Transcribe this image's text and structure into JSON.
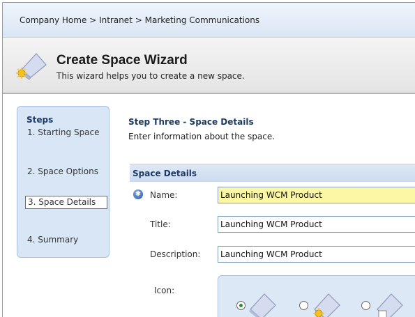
{
  "breadcrumb": {
    "items": [
      "Company Home",
      "Intranet",
      "Marketing Communications"
    ],
    "separator": ">"
  },
  "wizard": {
    "title": "Create Space Wizard",
    "subtitle": "This wizard helps you to create a new space.",
    "icon": "space-wizard-icon"
  },
  "steps": {
    "title": "Steps",
    "items": [
      {
        "label": "1. Starting Space",
        "active": false
      },
      {
        "label": "2. Space Options",
        "active": false
      },
      {
        "label": "3. Space Details",
        "active": true
      },
      {
        "label": "4. Summary",
        "active": false
      }
    ]
  },
  "main": {
    "step_title": "Step Three - Space Details",
    "step_desc": "Enter information about the space.",
    "section_title": "Space Details",
    "required_icon": "required-asterisk-icon",
    "fields": {
      "name": {
        "label": "Name:",
        "value": "Launching WCM Product",
        "required": true
      },
      "title": {
        "label": "Title:",
        "value": "Launching WCM Product"
      },
      "description": {
        "label": "Description:",
        "value": "Launching WCM Product"
      }
    },
    "icon_label": "Icon:",
    "icon_options": [
      {
        "icon": "space-icon-plain",
        "selected": true
      },
      {
        "icon": "space-icon-star",
        "selected": false
      },
      {
        "icon": "space-icon-document",
        "selected": false
      }
    ]
  },
  "colors": {
    "breadcrumb_bg": "#dbe7f5",
    "steps_bg": "#d8e6f6",
    "required_field_bg": "#fbf7a5",
    "heading_blue": "#1e3a66"
  }
}
